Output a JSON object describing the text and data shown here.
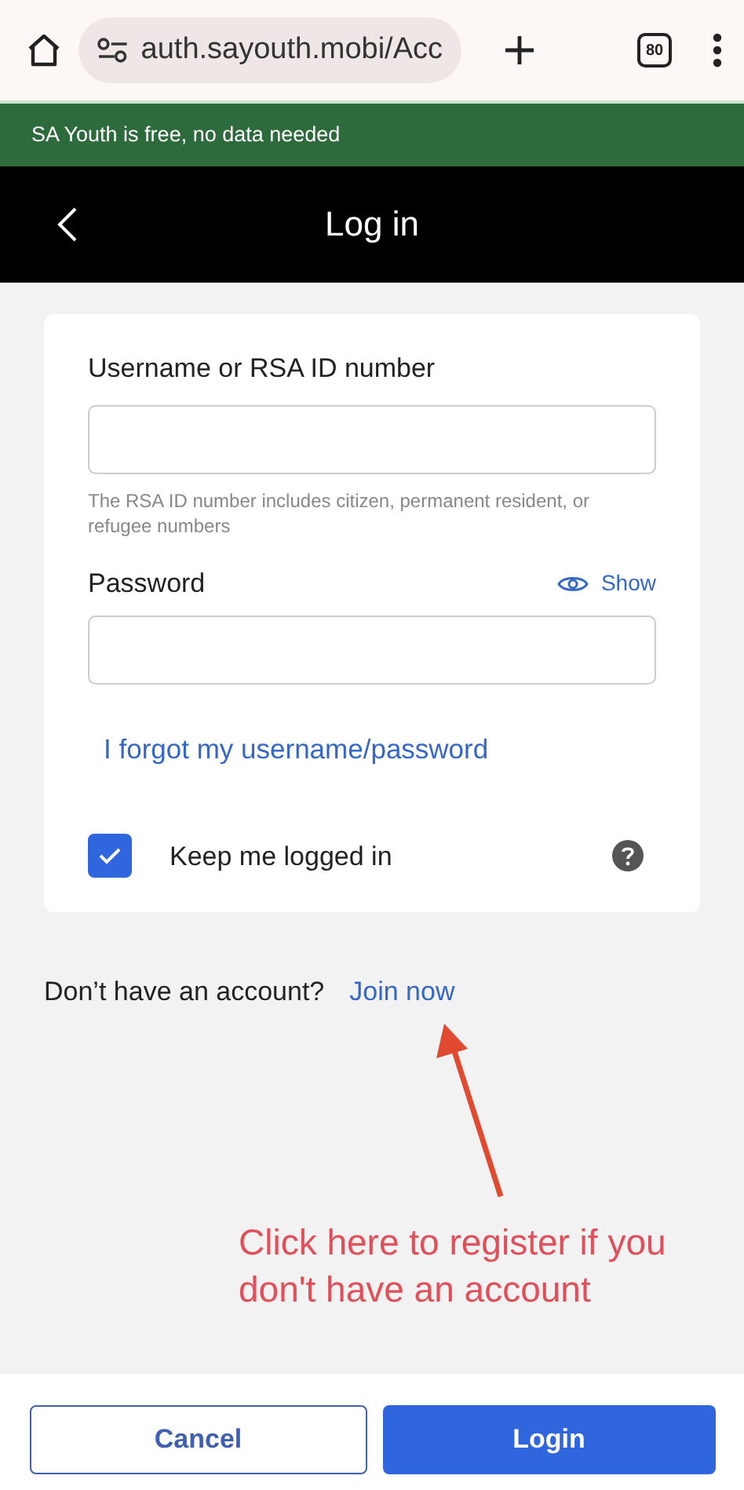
{
  "browser": {
    "url": "auth.sayouth.mobi/Acc",
    "tab_count": "80"
  },
  "banner": "SA Youth is free, no data needed",
  "header": {
    "title": "Log in"
  },
  "form": {
    "username_label": "Username or RSA ID number",
    "username_hint": "The RSA ID number includes citizen, permanent resident, or refugee numbers",
    "password_label": "Password",
    "show_label": "Show",
    "forgot_link": "I forgot my username/password",
    "keep_logged_in": {
      "label": "Keep me logged in",
      "checked": true
    }
  },
  "signup": {
    "prompt": "Don’t have an account?",
    "link": "Join now"
  },
  "annotation": "Click here to register if you don't have an account",
  "buttons": [
    {
      "label": "Cancel",
      "kind": "secondary"
    },
    {
      "label": "Login",
      "kind": "primary"
    }
  ]
}
